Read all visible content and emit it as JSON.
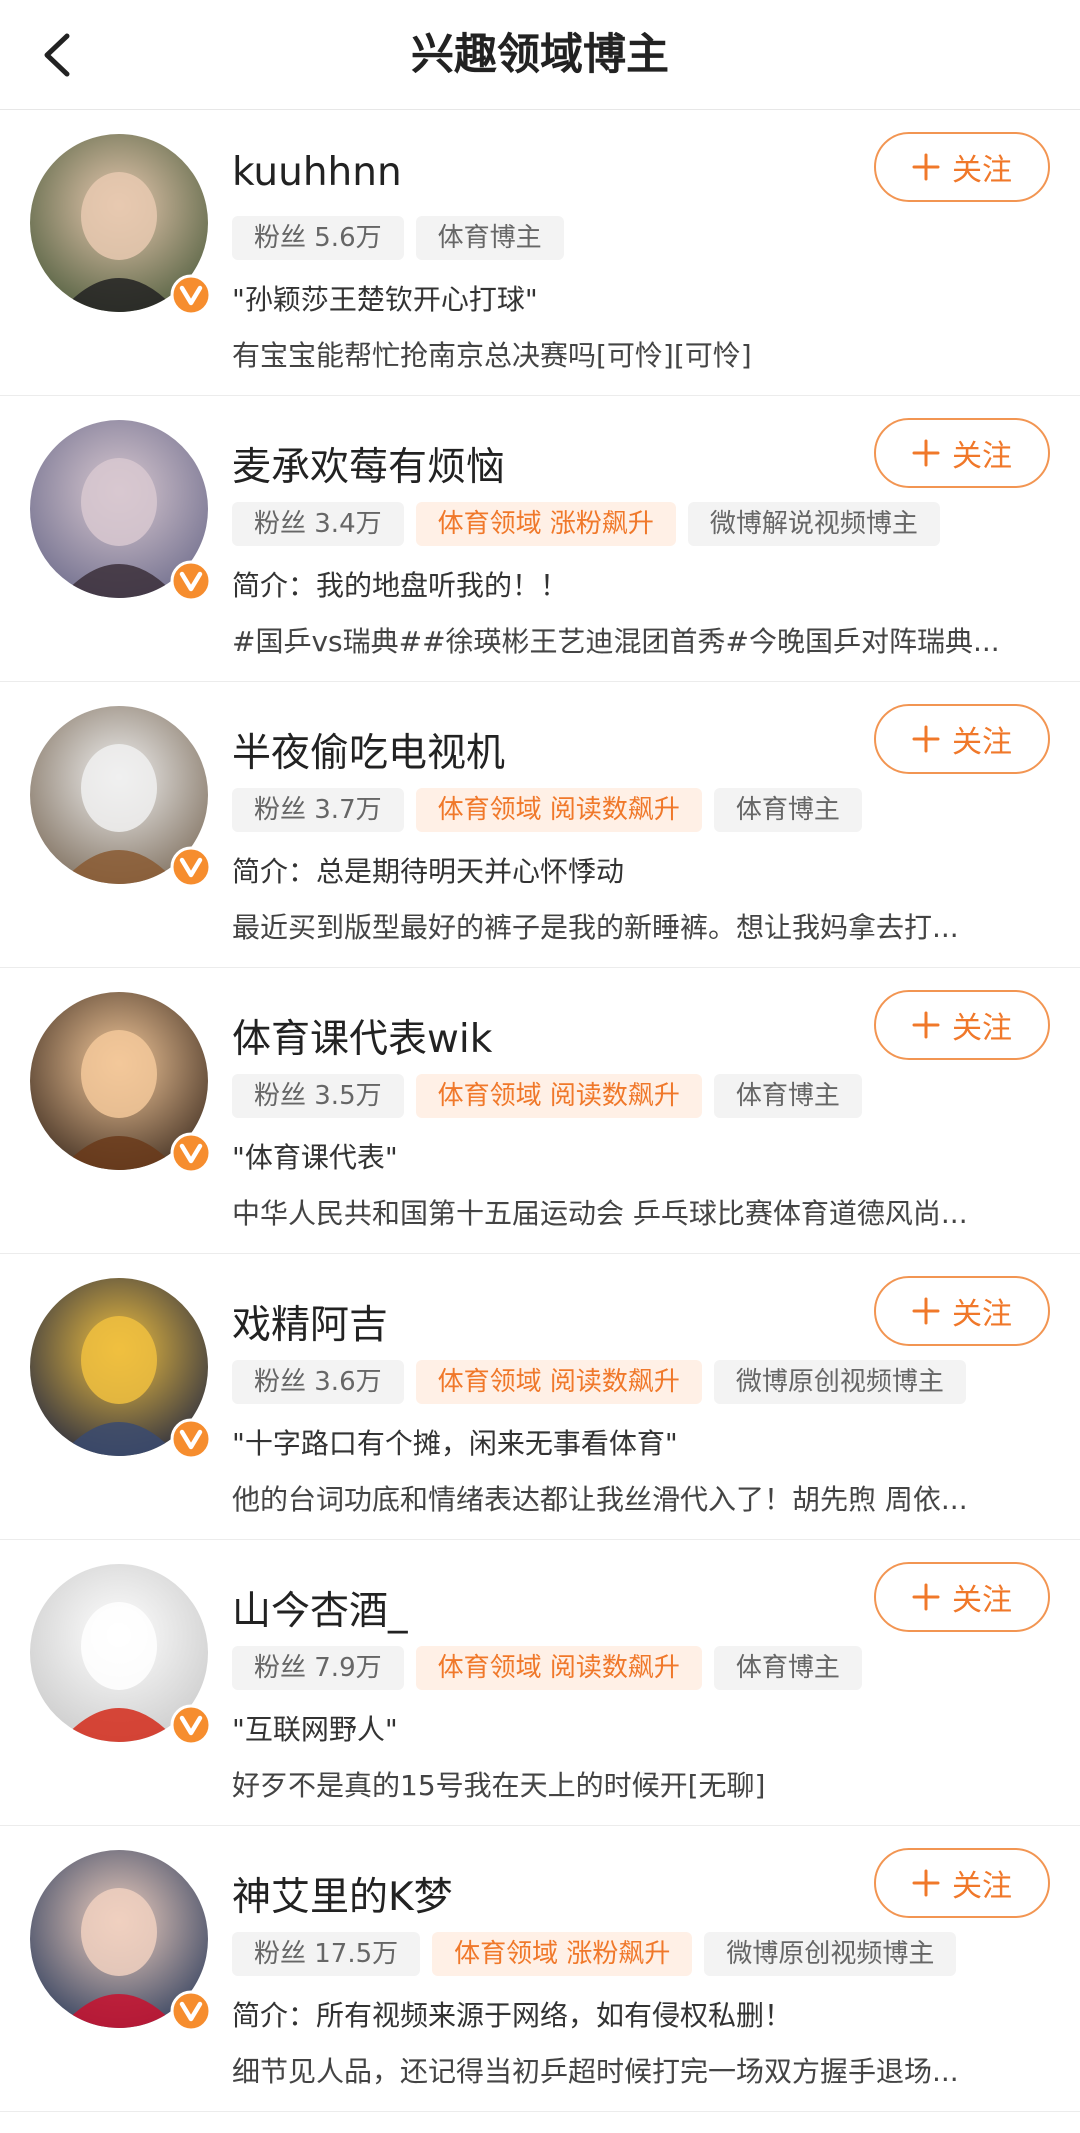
{
  "header": {
    "title": "兴趣领域博主"
  },
  "follow_label": "关注",
  "colors": {
    "accent": "#f0782a",
    "verify": "#f68d2e"
  },
  "bloggers": [
    {
      "name": "kuuhhnn",
      "tags": [
        {
          "text": "粉丝 5.6万",
          "hot": false
        },
        {
          "text": "体育博主",
          "hot": false
        }
      ],
      "intro": "\"孙颖莎王楚钦开心打球\"",
      "desc": "有宝宝能帮忙抢南京总决赛吗[可怜][可怜]",
      "avatar_icon": "avatar-young-man-peace-sign"
    },
    {
      "name": "麦承欢莓有烦恼",
      "tags": [
        {
          "text": "粉丝 3.4万",
          "hot": false
        },
        {
          "text": "体育领域 涨粉飙升",
          "hot": true
        },
        {
          "text": "微博解说视频博主",
          "hot": false
        }
      ],
      "intro": "简介：我的地盘听我的！！",
      "desc": "#国乒vs瑞典##徐瑛彬王艺迪混团首秀#今晚国乒对阵瑞典...",
      "avatar_icon": "avatar-anime-girl"
    },
    {
      "name": "半夜偷吃电视机",
      "tags": [
        {
          "text": "粉丝 3.7万",
          "hot": false
        },
        {
          "text": "体育领域 阅读数飙升",
          "hot": true
        },
        {
          "text": "体育博主",
          "hot": false
        }
      ],
      "intro": "简介：总是期待明天并心怀悸动",
      "desc": "最近买到版型最好的裤子是我的新睡裤。想让我妈拿去打...",
      "avatar_icon": "avatar-beagle-puppy"
    },
    {
      "name": "体育课代表wik",
      "tags": [
        {
          "text": "粉丝 3.5万",
          "hot": false
        },
        {
          "text": "体育领域 阅读数飙升",
          "hot": true
        },
        {
          "text": "体育博主",
          "hot": false
        }
      ],
      "intro": "\"体育课代表\"",
      "desc": "中华人民共和国第十五届运动会 乒乓球比赛体育道德风尚...",
      "avatar_icon": "avatar-woman-sunset"
    },
    {
      "name": "戏精阿吉",
      "tags": [
        {
          "text": "粉丝 3.6万",
          "hot": false
        },
        {
          "text": "体育领域 阅读数飙升",
          "hot": true
        },
        {
          "text": "微博原创视频博主",
          "hot": false
        }
      ],
      "intro": "\"十字路口有个摊，闲来无事看体育\"",
      "desc": "他的台词功底和情绪表达都让我丝滑代入了！胡先煦 周依...",
      "avatar_icon": "avatar-night-fish-illustration"
    },
    {
      "name": "山今杏酒_",
      "tags": [
        {
          "text": "粉丝 7.9万",
          "hot": false
        },
        {
          "text": "体育领域 阅读数飙升",
          "hot": true
        },
        {
          "text": "体育博主",
          "hot": false
        }
      ],
      "intro": "\"互联网野人\"",
      "desc": "好歹不是真的15号我在天上的时候开[无聊]",
      "avatar_icon": "avatar-white-dog-red-cap"
    },
    {
      "name": "神艾里的K梦",
      "tags": [
        {
          "text": "粉丝 17.5万",
          "hot": false
        },
        {
          "text": "体育领域 涨粉飙升",
          "hot": true
        },
        {
          "text": "微博原创视频博主",
          "hot": false
        }
      ],
      "intro": "简介：所有视频来源于网络，如有侵权私删！",
      "desc": "细节见人品，还记得当初乒超时候打完一场双方握手退场...",
      "avatar_icon": "avatar-two-table-tennis-players"
    }
  ]
}
